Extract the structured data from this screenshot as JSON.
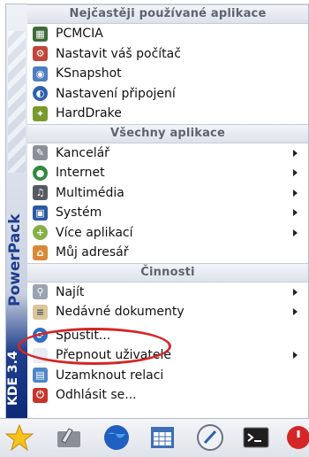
{
  "sidebar": {
    "brand": "PowerPack",
    "version": "KDE 3.4"
  },
  "sections": {
    "frequent": {
      "header": "Nejčastěji používané aplikace",
      "items": [
        {
          "label": "PCMCIA",
          "icon": "pcmcia-card-icon",
          "submenu": false
        },
        {
          "label": "Nastavit váš počítač",
          "icon": "computer-config-icon",
          "submenu": false
        },
        {
          "label": "KSnapshot",
          "icon": "ksnapshot-icon",
          "submenu": false
        },
        {
          "label": "Nastavení připojení",
          "icon": "network-connection-icon",
          "submenu": false
        },
        {
          "label": "HardDrake",
          "icon": "harddrake-icon",
          "submenu": false
        }
      ]
    },
    "all": {
      "header": "Všechny aplikace",
      "items": [
        {
          "label": "Kancelář",
          "icon": "office-icon",
          "submenu": true
        },
        {
          "label": "Internet",
          "icon": "globe-icon",
          "submenu": true
        },
        {
          "label": "Multimédia",
          "icon": "multimedia-icon",
          "submenu": true
        },
        {
          "label": "Systém",
          "icon": "system-icon",
          "submenu": true
        },
        {
          "label": "Více aplikací",
          "icon": "more-apps-icon",
          "submenu": true
        },
        {
          "label": "Můj adresář",
          "icon": "home-folder-icon",
          "submenu": false
        }
      ]
    },
    "actions": {
      "header": "Činnosti",
      "items": [
        {
          "label": "Najít",
          "icon": "find-icon",
          "submenu": true
        },
        {
          "label": "Nedávné dokumenty",
          "icon": "recent-documents-icon",
          "submenu": true
        },
        {
          "label": "Spustit...",
          "icon": "run-command-icon",
          "submenu": false
        },
        {
          "label": "Přepnout uživatele",
          "icon": "switch-user-icon",
          "submenu": true
        },
        {
          "label": "Uzamknout relaci",
          "icon": "lock-session-icon",
          "submenu": false
        },
        {
          "label": "Odhlásit se...",
          "icon": "logout-icon",
          "submenu": false
        }
      ]
    }
  },
  "highlighted_item": "Spustit...",
  "highlight_color": "#d42626",
  "taskbar": [
    {
      "icon": "kmenu-star-icon"
    },
    {
      "icon": "control-center-icon"
    },
    {
      "icon": "browser-globe-icon"
    },
    {
      "icon": "calendar-spreadsheet-icon"
    },
    {
      "icon": "text-editor-icon"
    },
    {
      "icon": "terminal-icon"
    },
    {
      "icon": "shutdown-icon"
    }
  ]
}
